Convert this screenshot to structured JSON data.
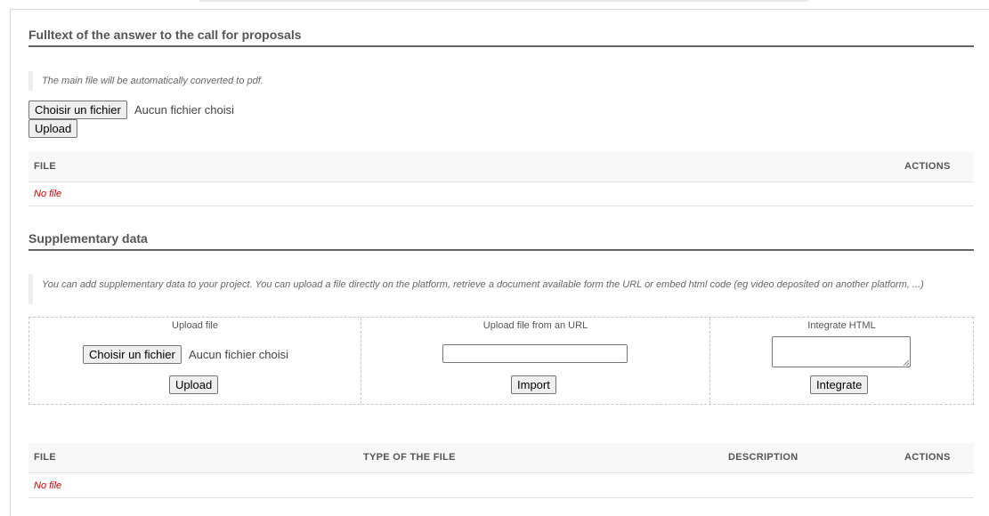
{
  "section1": {
    "title": "Fulltext of the answer to the call for proposals",
    "note": "The main file will be automatically converted to pdf.",
    "choose_file_label": "Choisir un fichier",
    "no_file_chosen": "Aucun fichier choisi",
    "upload_label": "Upload",
    "table": {
      "headers": [
        "FILE",
        "ACTIONS"
      ],
      "empty_text": "No file"
    }
  },
  "section2": {
    "title": "Supplementary data",
    "note": "You can add supplementary data to your project. You can upload a file directly on the platform, retrieve a document available form the URL or embed html code (eg video deposited on another platform, ...)",
    "upload_file": {
      "title": "Upload file",
      "choose_file_label": "Choisir un fichier",
      "no_file_chosen": "Aucun fichier choisi",
      "upload_label": "Upload"
    },
    "upload_url": {
      "title": "Upload file from an URL",
      "url_value": "",
      "import_label": "Import"
    },
    "integrate_html": {
      "title": "Integrate HTML",
      "html_value": "",
      "integrate_label": "Integrate"
    },
    "table": {
      "headers": [
        "FILE",
        "TYPE OF THE FILE",
        "DESCRIPTION",
        "ACTIONS"
      ],
      "empty_text": "No file"
    }
  },
  "colors": {
    "error": "#cc0000",
    "table_header_bg": "#f8f8f8",
    "title_rule": "#666666"
  }
}
